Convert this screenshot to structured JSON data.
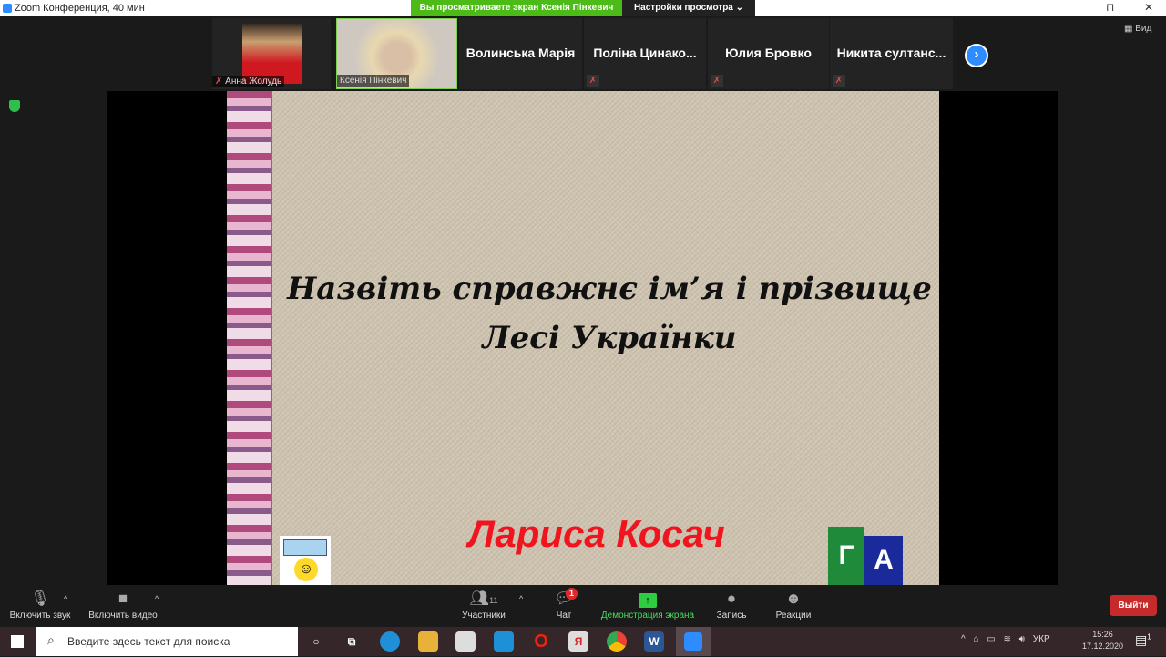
{
  "window": {
    "title": "Zoom Конференция, 40 мин",
    "minimize": "⊓",
    "close": "✕"
  },
  "banner": {
    "text": "Вы просматриваете экран Ксенія Пінкевич",
    "view_options": "Настройки просмотра ⌄"
  },
  "participants": [
    {
      "name": "Анна Жолудь",
      "muted": true,
      "video": true
    },
    {
      "name": "Ксенія Пінкевич",
      "muted": false,
      "video": true,
      "active": true
    },
    {
      "name": "Волинська Марія",
      "muted": false
    },
    {
      "name": "Поліна Цинако...",
      "muted": true
    },
    {
      "name": "Юлия Бровко",
      "muted": true
    },
    {
      "name": "Никита  султанс...",
      "muted": true
    }
  ],
  "view_button": "▦ Вид",
  "slide": {
    "question_line1": "Назвіть справжнє  ім’я і прізвище",
    "question_line2": "Лесі Українки",
    "answer": "Лариса  Косач",
    "logo_letters": [
      "Г",
      "А"
    ]
  },
  "toolbar": {
    "unmute": "Включить звук",
    "start_video": "Включить видео",
    "participants": "Участники",
    "participants_count": "11",
    "chat": "Чат",
    "chat_badge": "1",
    "share": "Демонстрация экрана",
    "record": "Запись",
    "reactions": "Реакции",
    "leave": "Выйти"
  },
  "taskbar": {
    "search_placeholder": "Введите здесь текст для поиска",
    "lang": "УКР",
    "time": "15:26",
    "date": "17.12.2020",
    "notifications": "1"
  },
  "colors": {
    "zoom_blue": "#2d8cff",
    "share_green": "#4cbb17",
    "leave_red": "#c72a2a"
  }
}
